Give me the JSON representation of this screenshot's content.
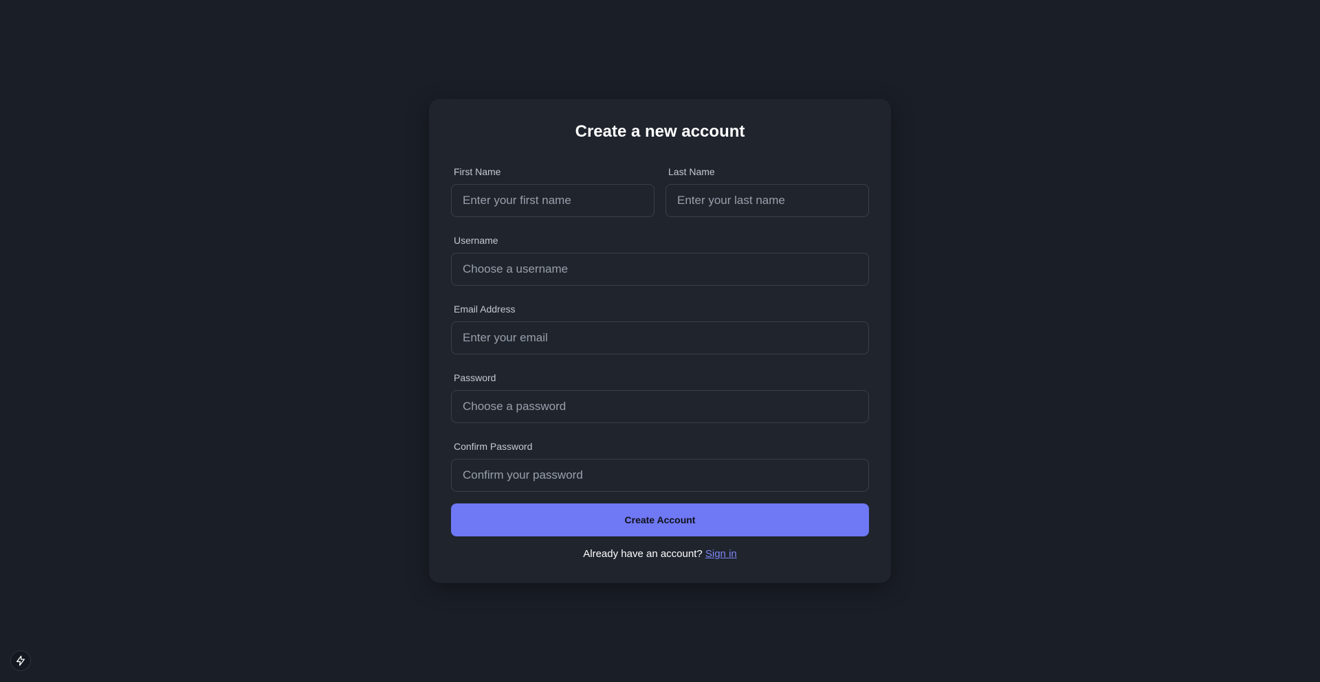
{
  "form": {
    "title": "Create a new account",
    "first_name": {
      "label": "First Name",
      "placeholder": "Enter your first name"
    },
    "last_name": {
      "label": "Last Name",
      "placeholder": "Enter your last name"
    },
    "username": {
      "label": "Username",
      "placeholder": "Choose a username"
    },
    "email": {
      "label": "Email Address",
      "placeholder": "Enter your email"
    },
    "password": {
      "label": "Password",
      "placeholder": "Choose a password"
    },
    "confirm_password": {
      "label": "Confirm Password",
      "placeholder": "Confirm your password"
    },
    "submit_label": "Create Account",
    "footer_text": "Already have an account?",
    "signin_link": "Sign in"
  },
  "corner_badge": {
    "icon": "lightning-bolt-icon"
  },
  "colors": {
    "background": "#1a1e26",
    "card": "#1f242d",
    "accent": "#6f78f5",
    "link": "#7f88f8"
  }
}
